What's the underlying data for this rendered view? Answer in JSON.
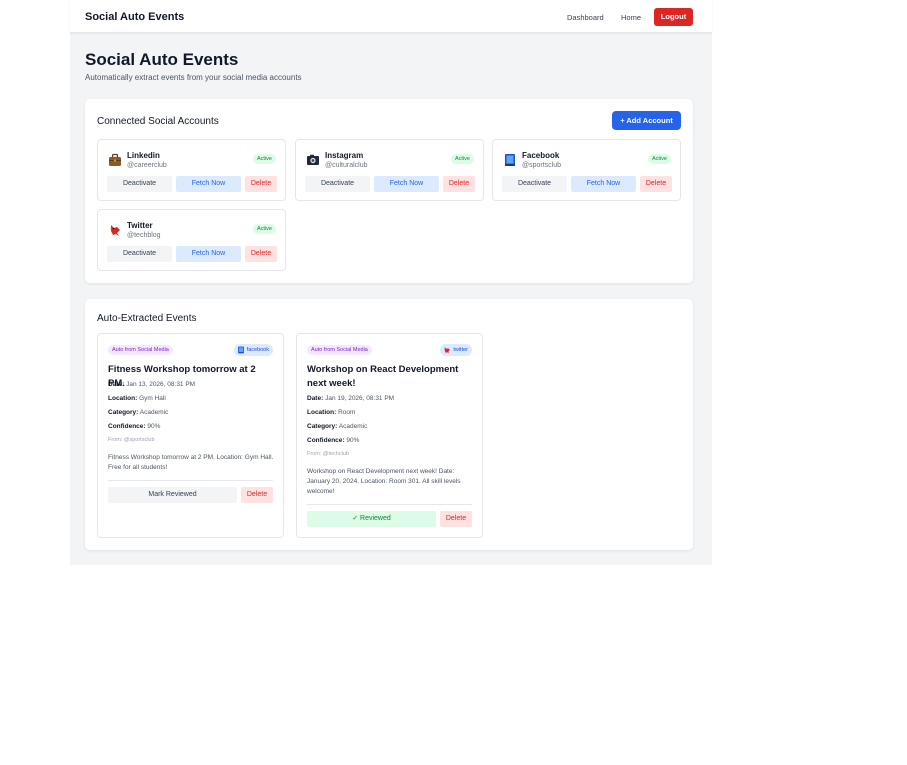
{
  "navbar": {
    "brand": "Social Auto Events",
    "dashboard_label": "Dashboard",
    "home_label": "Home",
    "logout_label": "Logout"
  },
  "header": {
    "title": "Social Auto Events",
    "subtitle": "Automatically extract events from your social media accounts"
  },
  "accounts_panel": {
    "title": "Connected Social Accounts",
    "add_button_label": "+ Add Account",
    "accounts": [
      {
        "name": "Linkedin",
        "handle": "@careerclub",
        "status": "Active",
        "icon": "briefcase-icon",
        "deactivate_label": "Deactivate",
        "fetch_label": "Fetch Now",
        "delete_label": "Delete"
      },
      {
        "name": "Instagram",
        "handle": "@culturalclub",
        "status": "Active",
        "icon": "camera-icon",
        "deactivate_label": "Deactivate",
        "fetch_label": "Fetch Now",
        "delete_label": "Delete"
      },
      {
        "name": "Facebook",
        "handle": "@sportsclub",
        "status": "Active",
        "icon": "book-icon",
        "deactivate_label": "Deactivate",
        "fetch_label": "Fetch Now",
        "delete_label": "Delete"
      },
      {
        "name": "Twitter",
        "handle": "@techblog",
        "status": "Active",
        "icon": "bird-icon",
        "deactivate_label": "Deactivate",
        "fetch_label": "Fetch Now",
        "delete_label": "Delete"
      }
    ]
  },
  "events_panel": {
    "title": "Auto-Extracted Events",
    "events": [
      {
        "badge": "Auto from Social Media",
        "source": "facebook",
        "source_icon": "book-icon",
        "title": "Fitness Workshop tomorrow at 2 PM.",
        "date_label": "Date:",
        "date": "Jan 13, 2026, 08:31 PM",
        "location_label": "Location:",
        "location": "Gym Hall",
        "category_label": "Category:",
        "category": "Academic",
        "confidence_label": "Confidence:",
        "confidence": "90%",
        "from": "From: @sportsclub",
        "description": "Fitness Workshop tomorrow at 2 PM. Location: Gym Hall. Free for all students!",
        "review_label": "Mark Reviewed",
        "reviewed": false,
        "delete_label": "Delete"
      },
      {
        "badge": "Auto from Social Media",
        "source": "twitter",
        "source_icon": "bird-icon",
        "title": "Workshop on React Development next week!",
        "date_label": "Date:",
        "date": "Jan 19, 2026, 08:31 PM",
        "location_label": "Location:",
        "location": "Room",
        "category_label": "Category:",
        "category": "Academic",
        "confidence_label": "Confidence:",
        "confidence": "90%",
        "from": "From: @techclub",
        "description": "Workshop on React Development next week! Date: January 20, 2024. Location: Room 301. All skill levels welcome!",
        "review_label": "✓ Reviewed",
        "reviewed": true,
        "delete_label": "Delete"
      }
    ]
  },
  "colors": {
    "primary": "#2563eb",
    "danger": "#dc2626",
    "success": "#15803d",
    "purple": "#7e22ce"
  }
}
